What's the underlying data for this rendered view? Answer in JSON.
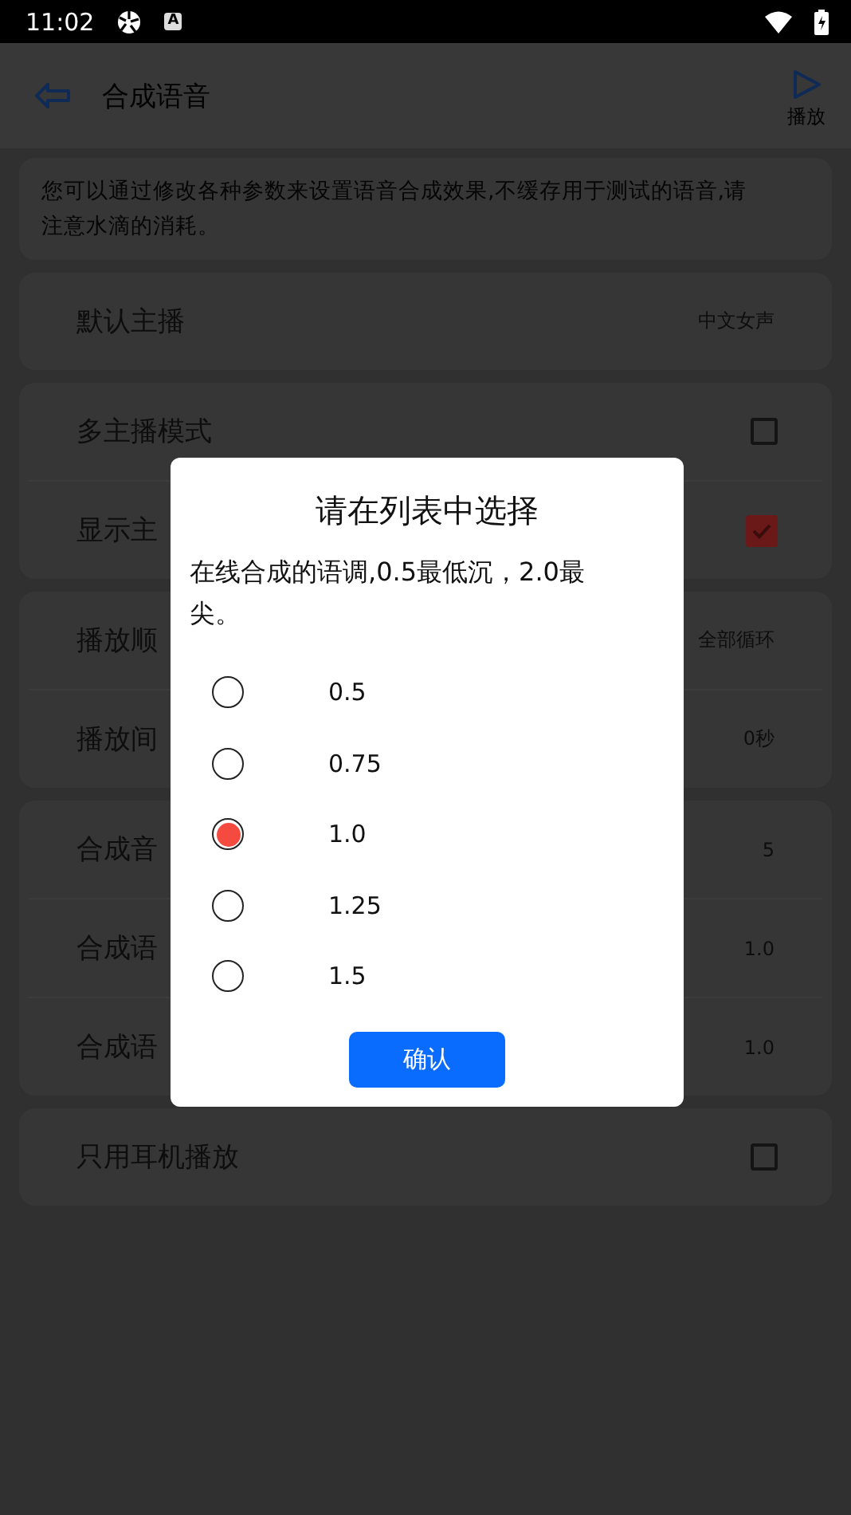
{
  "status_bar": {
    "time": "11:02",
    "badge": "A"
  },
  "toolbar": {
    "title": "合成语音",
    "action": "播放"
  },
  "description": "您可以通过修改各种参数来设置语音合成效果,不缓存用于测试的语音,请注意水滴的消耗。",
  "groups": [
    {
      "rows": [
        {
          "kind": "value",
          "label": "默认主播",
          "value": "中文女声"
        }
      ]
    },
    {
      "rows": [
        {
          "kind": "checkbox",
          "label": "多主播模式",
          "checked": false
        },
        {
          "kind": "checkbox",
          "label": "显示主",
          "checked": true
        }
      ]
    },
    {
      "rows": [
        {
          "kind": "value",
          "label": "播放顺",
          "value": "全部循环"
        },
        {
          "kind": "value",
          "label": "播放间",
          "value": "0秒"
        }
      ]
    },
    {
      "rows": [
        {
          "kind": "value",
          "label": "合成音",
          "value": "5"
        },
        {
          "kind": "value",
          "label": "合成语",
          "value": "1.0"
        },
        {
          "kind": "value",
          "label": "合成语",
          "value": "1.0"
        }
      ]
    },
    {
      "rows": [
        {
          "kind": "checkbox",
          "label": "只用耳机播放",
          "checked": false
        }
      ]
    }
  ],
  "dialog": {
    "title": "请在列表中选择",
    "message": "在线合成的语调,0.5最低沉，2.0最尖。",
    "options": [
      {
        "label": "0.5",
        "selected": false
      },
      {
        "label": "0.75",
        "selected": false
      },
      {
        "label": "1.0",
        "selected": true
      },
      {
        "label": "1.25",
        "selected": false
      },
      {
        "label": "1.5",
        "selected": false
      }
    ],
    "confirm": "确认"
  }
}
